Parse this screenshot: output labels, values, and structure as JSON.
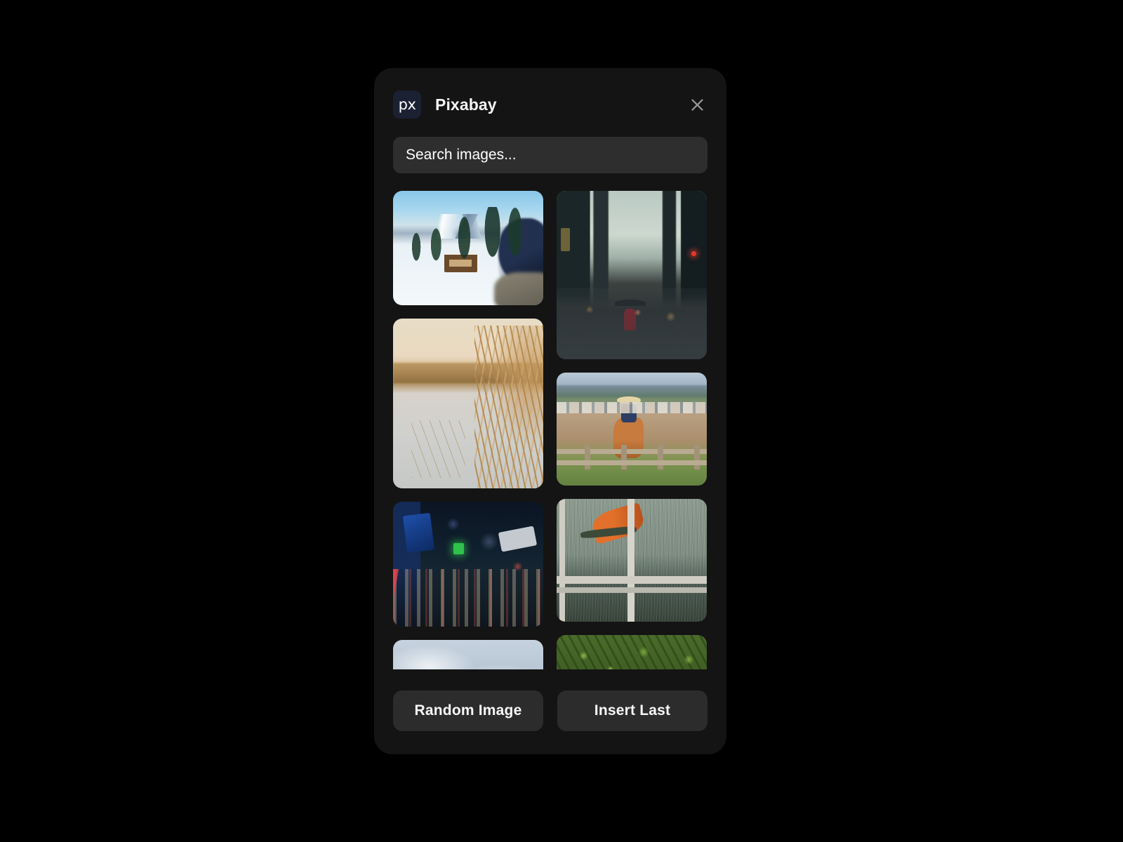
{
  "modal": {
    "logo_glyph": "px",
    "title": "Pixabay",
    "close_label": "×"
  },
  "search": {
    "value": "",
    "placeholder": "Search images..."
  },
  "gallery": {
    "columns": [
      {
        "items": [
          {
            "name": "snowy-mountain-cabin",
            "alt": "Snow covered cabin with pine trees and mountains"
          },
          {
            "name": "golden-reeds-lake",
            "alt": "Golden reeds beside a calm misty lake"
          },
          {
            "name": "times-square-night",
            "alt": "Times Square at night with neon billboards"
          },
          {
            "name": "cloudy-sky",
            "alt": "Overcast cloudy sky"
          }
        ]
      },
      {
        "items": [
          {
            "name": "rainy-city-street",
            "alt": "Rainy city street with person in red coat and umbrella"
          },
          {
            "name": "rodeo-horse-rider",
            "alt": "Rodeo rider on horseback behind a wooden fence"
          },
          {
            "name": "rainy-window-flower",
            "alt": "Bird of paradise flower behind a rain streaked window"
          },
          {
            "name": "green-foliage-red-car",
            "alt": "Green foliage with a red car below"
          }
        ]
      }
    ]
  },
  "footer": {
    "random_image_label": "Random Image",
    "insert_last_label": "Insert Last"
  },
  "colors": {
    "page_background": "#000000",
    "panel_background": "#141414",
    "input_background": "#2e2e2e",
    "button_background": "#2c2c2c",
    "logo_badge_background": "#1b2033",
    "text_primary": "#ffffff",
    "close_icon": "#9a9a9a"
  }
}
